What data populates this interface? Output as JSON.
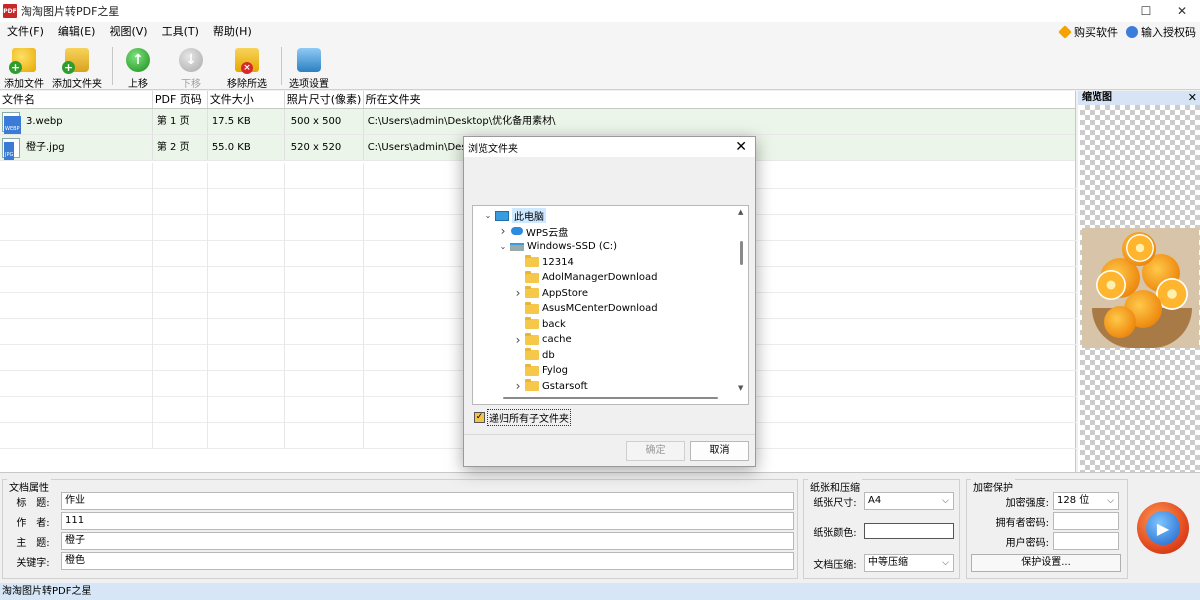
{
  "window": {
    "title": "淘淘图片转PDF之星"
  },
  "menu": {
    "items": [
      "文件(F)",
      "编辑(E)",
      "视图(V)",
      "工具(T)",
      "帮助(H)"
    ],
    "buy": "购买软件",
    "license": "输入授权码"
  },
  "toolbar": {
    "add_file": "添加文件",
    "add_folder": "添加文件夹",
    "move_up": "上移",
    "move_down": "下移",
    "remove_selected": "移除所选",
    "options": "选项设置"
  },
  "table": {
    "headers": [
      "文件名",
      "PDF 页码",
      "文件大小",
      "照片尺寸(像素)",
      "所在文件夹"
    ],
    "rows": [
      {
        "name": "3.webp",
        "page": "第 1 页",
        "size": "17.5 KB",
        "dims": "500 x 500",
        "folder": "C:\\Users\\admin\\Desktop\\优化备用素材\\"
      },
      {
        "name": "橙子.jpg",
        "page": "第 2 页",
        "size": "55.0 KB",
        "dims": "520 x 520",
        "folder": "C:\\Users\\admin\\Desktop\\"
      }
    ]
  },
  "preview": {
    "title": "缩览图"
  },
  "doc_props": {
    "title": "文档属性",
    "title_label": "标　题:",
    "title_value": "作业",
    "author_label": "作　者:",
    "author_value": "111",
    "subject_label": "主　题:",
    "subject_value": "橙子",
    "keywords_label": "关键字:",
    "keywords_value": "橙色"
  },
  "paper": {
    "title": "纸张和压缩",
    "size_label": "纸张尺寸:",
    "size_value": "A4",
    "color_label": "纸张颜色:",
    "compress_label": "文档压缩:",
    "compress_value": "中等压缩"
  },
  "encryption": {
    "title": "加密保护",
    "strength_label": "加密强度:",
    "strength_value": "128 位",
    "owner_label": "拥有者密码:",
    "user_label": "用户密码:",
    "settings_button": "保护设置..."
  },
  "status": {
    "text": "淘淘图片转PDF之星"
  },
  "dialog": {
    "title": "浏览文件夹",
    "tree": [
      {
        "label": "此电脑",
        "depth": 0,
        "expander": "v",
        "icon": "pc"
      },
      {
        "label": "WPS云盘",
        "depth": 1,
        "expander": ">",
        "icon": "cloud"
      },
      {
        "label": "Windows-SSD (C:)",
        "depth": 1,
        "expander": "v",
        "icon": "drive"
      },
      {
        "label": "12314",
        "depth": 2,
        "expander": "",
        "icon": "folder"
      },
      {
        "label": "AdolManagerDownload",
        "depth": 2,
        "expander": "",
        "icon": "folder"
      },
      {
        "label": "AppStore",
        "depth": 2,
        "expander": ">",
        "icon": "folder"
      },
      {
        "label": "AsusMCenterDownload",
        "depth": 2,
        "expander": "",
        "icon": "folder"
      },
      {
        "label": "back",
        "depth": 2,
        "expander": "",
        "icon": "folder"
      },
      {
        "label": "cache",
        "depth": 2,
        "expander": ">",
        "icon": "folder"
      },
      {
        "label": "db",
        "depth": 2,
        "expander": "",
        "icon": "folder"
      },
      {
        "label": "Fylog",
        "depth": 2,
        "expander": "",
        "icon": "folder"
      },
      {
        "label": "Gstarsoft",
        "depth": 2,
        "expander": ">",
        "icon": "folder"
      }
    ],
    "recursive_label": "递归所有子文件夹",
    "ok": "确定",
    "cancel": "取消"
  }
}
